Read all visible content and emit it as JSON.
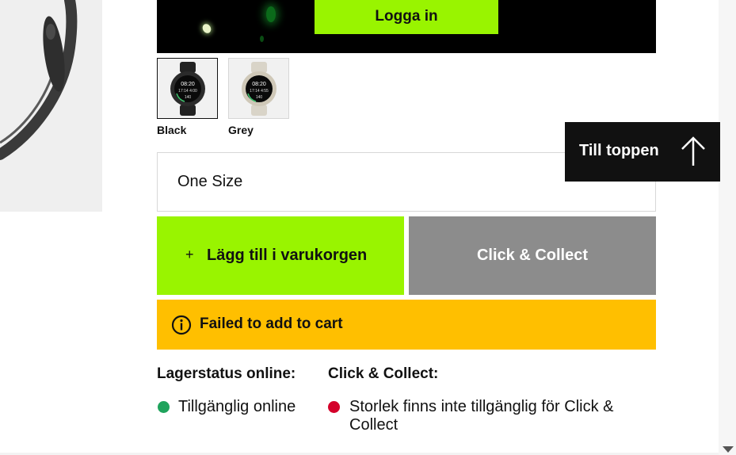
{
  "banner": {
    "login_label": "Logga in"
  },
  "swatches": [
    {
      "label": "Black",
      "selected": true
    },
    {
      "label": "Grey",
      "selected": false
    }
  ],
  "size": {
    "selected": "One Size"
  },
  "to_top": {
    "label": "Till toppen",
    "icon": "arrow-up-icon"
  },
  "actions": {
    "add_to_cart_icon": "+",
    "add_to_cart_label": "Lägg till i varukorgen",
    "click_collect_label": "Click & Collect"
  },
  "alert": {
    "icon": "info-icon",
    "message": "Failed to add to cart"
  },
  "stock": {
    "online_title": "Lagerstatus online:",
    "online_status": "Tillgänglig online",
    "collect_title": "Click & Collect:",
    "collect_status_line1": "Storlek finns inte tillgänglig för Click &",
    "collect_status_line2": "Collect"
  },
  "colors": {
    "accent_green": "#99f400",
    "warning_yellow": "#ffbf00",
    "status_available": "#1fa35c",
    "status_unavailable": "#d4002a",
    "disabled_gray": "#8c8c8c"
  }
}
